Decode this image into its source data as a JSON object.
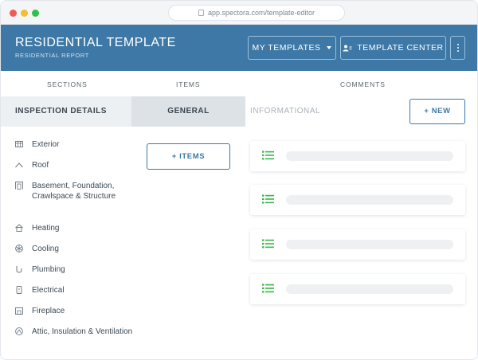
{
  "browser": {
    "url": "app.spectora.com/template-editor"
  },
  "header": {
    "title": "RESIDENTIAL TEMPLATE",
    "subtitle": "RESIDENTIAL REPORT",
    "my_templates_label": "MY TEMPLATES",
    "template_center_label": "TEMPLATE CENTER",
    "bg_color": "#3d78a6"
  },
  "columns": {
    "sections": "SECTIONS",
    "items": "ITEMS",
    "comments": "COMMENTS"
  },
  "tabs": {
    "sections_active": "INSPECTION DETAILS",
    "items_active": "GENERAL",
    "comments_active": "INFORMATIONAL",
    "new_label": "+ NEW"
  },
  "items_button_label": "+ ITEMS",
  "sections": [
    {
      "label": "Exterior",
      "icon": "exterior-icon"
    },
    {
      "label": "Roof",
      "icon": "roof-icon"
    },
    {
      "label": "Basement, Foundation, Crawlspace & Structure",
      "icon": "basement-icon"
    },
    {
      "label": "Heating",
      "icon": "heating-icon"
    },
    {
      "label": "Cooling",
      "icon": "cooling-icon"
    },
    {
      "label": "Plumbing",
      "icon": "plumbing-icon"
    },
    {
      "label": "Electrical",
      "icon": "electrical-icon"
    },
    {
      "label": "Fireplace",
      "icon": "fireplace-icon"
    },
    {
      "label": "Attic, Insulation & Ventilation",
      "icon": "attic-icon"
    }
  ],
  "comment_cards": [
    {
      "icon": "list-icon"
    },
    {
      "icon": "list-icon"
    },
    {
      "icon": "list-icon"
    },
    {
      "icon": "list-icon"
    }
  ],
  "colors": {
    "accent": "#3d78a6",
    "list_icon": "#3ab54a"
  }
}
